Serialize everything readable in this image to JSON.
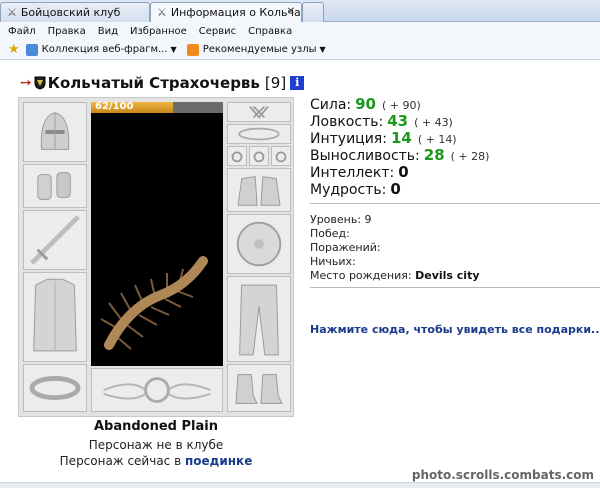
{
  "tabs": [
    {
      "label": "Бойцовский клуб",
      "active": false
    },
    {
      "label": "Информация о Кольчаты...",
      "active": true
    }
  ],
  "menu": [
    "Файл",
    "Правка",
    "Вид",
    "Избранное",
    "Сервис",
    "Справка"
  ],
  "favorites": {
    "web_slices": "Коллекция веб-фрагм...",
    "suggested": "Рекомендуемые узлы"
  },
  "character": {
    "name": "Кольчатый Страхочервь",
    "level": "[9]",
    "info_badge": "i",
    "hp": "62/100",
    "hp_fraction": 0.62,
    "location": "Abandoned Plain",
    "club_status": "Персонаж не в клубе",
    "activity_prefix": "Персонаж сейчас в",
    "activity_link": "поединке"
  },
  "stats": [
    {
      "label": "Сила:",
      "value": "90",
      "bonus": "( + 90)",
      "color": "#1a9a1a"
    },
    {
      "label": "Ловкость:",
      "value": "43",
      "bonus": "( + 43)",
      "color": "#1a9a1a"
    },
    {
      "label": "Интуиция:",
      "value": "14",
      "bonus": "( + 14)",
      "color": "#1a9a1a"
    },
    {
      "label": "Выносливость:",
      "value": "28",
      "bonus": "( + 28)",
      "color": "#1a9a1a"
    },
    {
      "label": "Интеллект:",
      "value": "0",
      "bonus": "",
      "color": "#111111"
    },
    {
      "label": "Мудрость:",
      "value": "0",
      "bonus": "",
      "color": "#111111"
    }
  ],
  "info": {
    "level": "Уровень: 9",
    "wins": "Побед:",
    "losses": "Поражений:",
    "draws": "Ничьих:",
    "birthplace_label": "Место рождения:",
    "birthplace": "Devils city"
  },
  "gifts_link": "Нажмите сюда, чтобы увидеть все подарки...",
  "watermark": "photo.scrolls.combats.com",
  "colors": {
    "accent_link": "#1a3a8c",
    "stat_green": "#1a9a1a",
    "hp_bar": "#e0a030"
  }
}
